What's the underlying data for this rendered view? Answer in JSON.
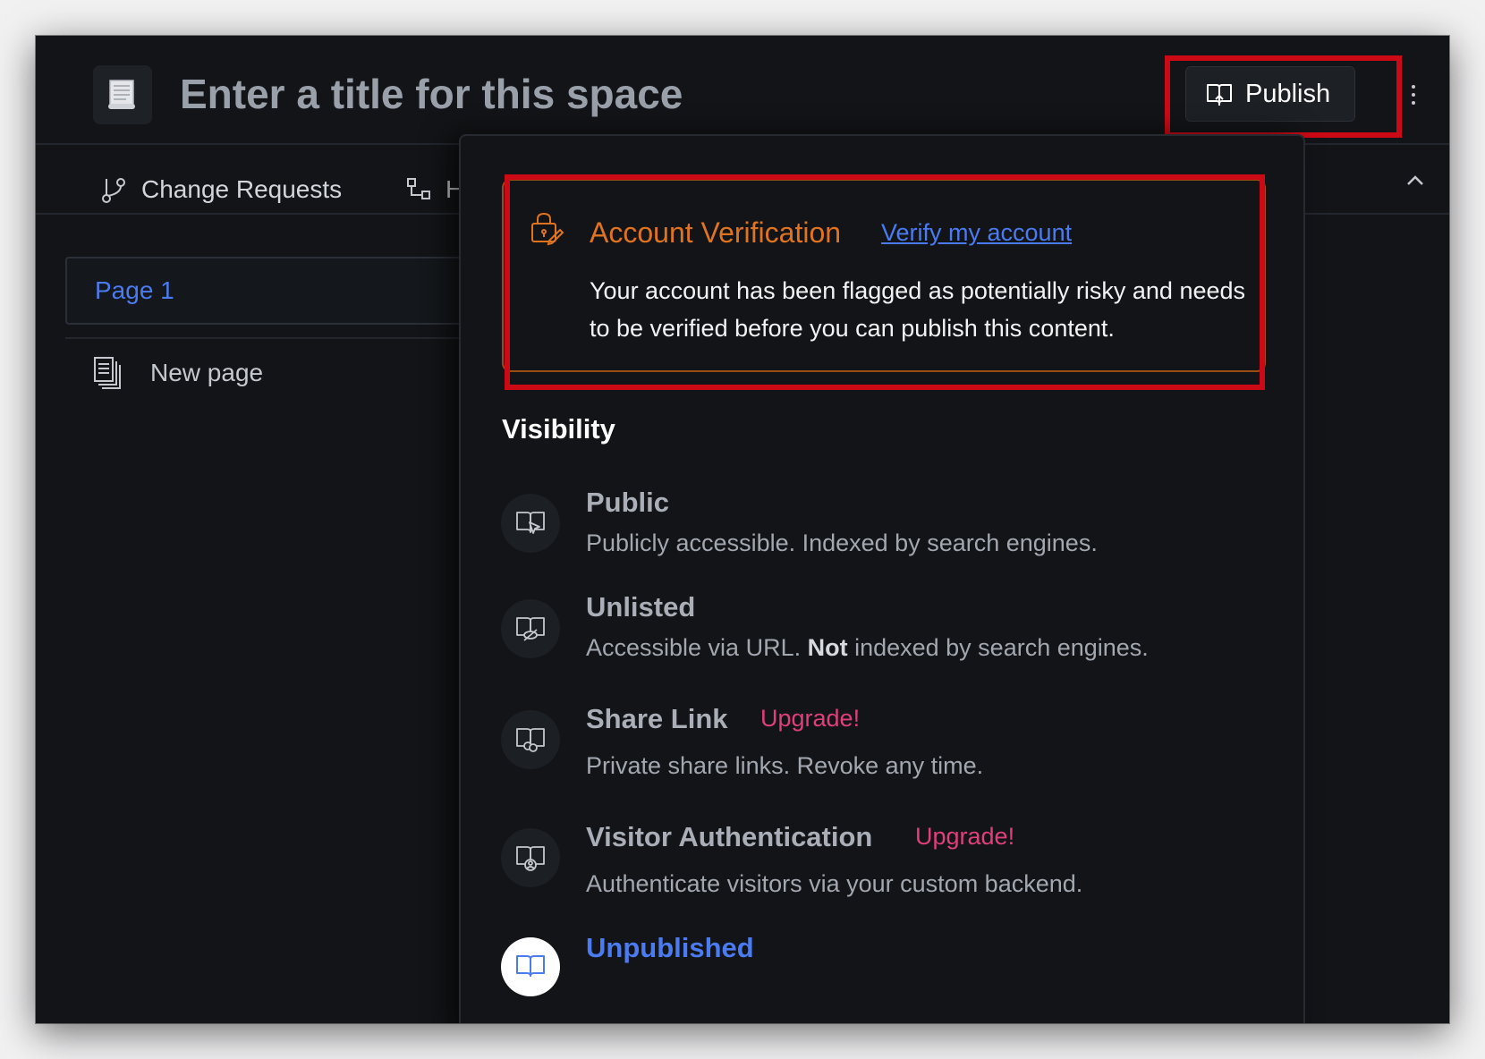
{
  "header": {
    "title_placeholder": "Enter a title for this space",
    "publish_label": "Publish",
    "space_icon": "scroll-emoji"
  },
  "tabs": {
    "change_requests": "Change Requests",
    "history_partial": "H"
  },
  "sidebar": {
    "pages": [
      {
        "label": "Page 1"
      }
    ],
    "new_page_label": "New page"
  },
  "popover": {
    "alert": {
      "title": "Account Verification",
      "link": "Verify my account",
      "message": "Your account has been flagged as potentially risky and needs to be verified before you can publish this content.",
      "icon": "lock-edit-icon",
      "color": "#e0731f"
    },
    "visibility_heading": "Visibility",
    "options": [
      {
        "title": "Public",
        "desc": "Publicly accessible. Indexed by search engines.",
        "icon": "book-cursor-icon"
      },
      {
        "title": "Unlisted",
        "desc_pre": "Accessible via URL. ",
        "desc_bold": "Not",
        "desc_post": " indexed by search engines.",
        "icon": "book-eye-off-icon"
      },
      {
        "title": "Share Link",
        "badge": "Upgrade!",
        "desc": "Private share links. Revoke any time.",
        "icon": "book-link-icon"
      },
      {
        "title": "Visitor Authentication",
        "badge": "Upgrade!",
        "desc": "Authenticate visitors via your custom backend.",
        "icon": "book-user-icon"
      },
      {
        "title": "Unpublished",
        "icon": "book-icon",
        "selected": true
      }
    ]
  },
  "colors": {
    "background": "#121417",
    "accent_blue": "#4b7bf0",
    "warning_orange": "#e0731f",
    "upgrade_pink": "#e0407a",
    "annotation_red": "#cc0a16"
  }
}
